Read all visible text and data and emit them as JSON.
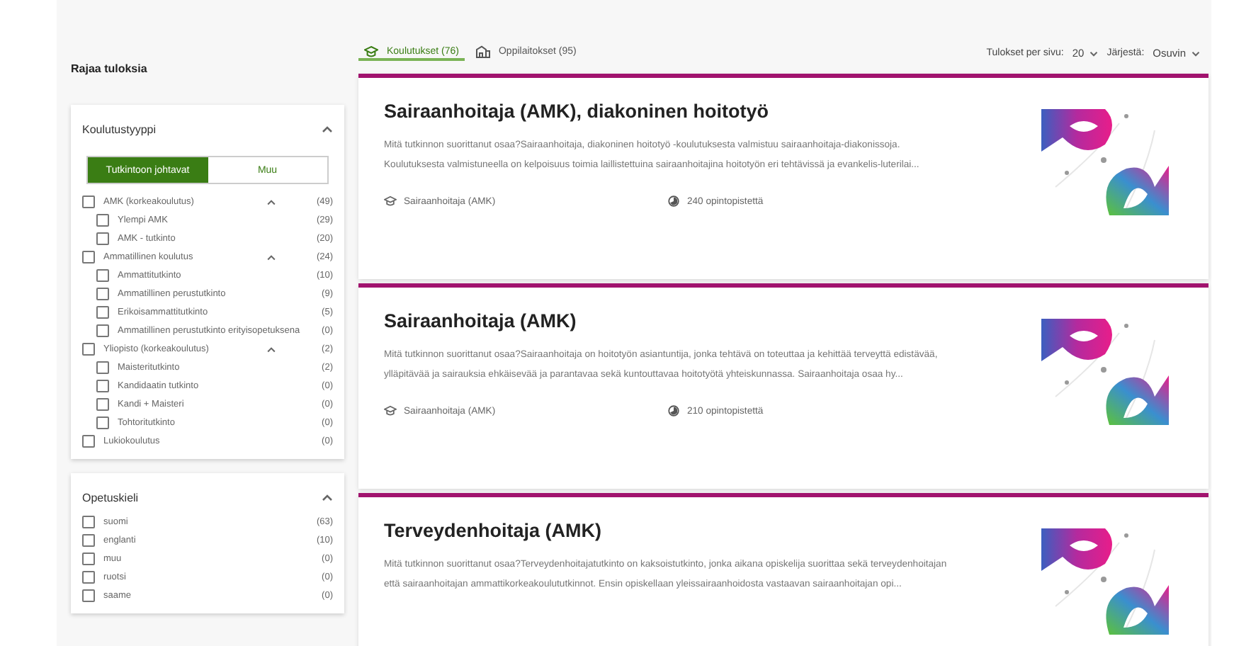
{
  "sidebar": {
    "title": "Rajaa tuloksia",
    "filters": [
      {
        "title": "Koulutustyyppi",
        "expanded": true,
        "toggle": [
          {
            "label": "Tutkintoon johtavat",
            "selected": true
          },
          {
            "label": "Muu",
            "selected": false
          }
        ],
        "items": [
          {
            "label": "AMK (korkeakoulutus)",
            "count": "(49)",
            "checked": false,
            "expanded": true,
            "children": [
              {
                "label": "Ylempi AMK",
                "count": "(29)",
                "checked": false
              },
              {
                "label": "AMK - tutkinto",
                "count": "(20)",
                "checked": false
              }
            ]
          },
          {
            "label": "Ammatillinen koulutus",
            "count": "(24)",
            "checked": false,
            "expanded": true,
            "children": [
              {
                "label": "Ammattitutkinto",
                "count": "(10)",
                "checked": false
              },
              {
                "label": "Ammatillinen perustutkinto",
                "count": "(9)",
                "checked": false
              },
              {
                "label": "Erikoisammattitutkinto",
                "count": "(5)",
                "checked": false
              },
              {
                "label": "Ammatillinen perustutkinto erityisopetuksena",
                "count": "(0)",
                "checked": false
              }
            ]
          },
          {
            "label": "Yliopisto (korkeakoulutus)",
            "count": "(2)",
            "checked": false,
            "expanded": true,
            "children": [
              {
                "label": "Maisteritutkinto",
                "count": "(2)",
                "checked": false
              },
              {
                "label": "Kandidaatin tutkinto",
                "count": "(0)",
                "checked": false
              },
              {
                "label": "Kandi + Maisteri",
                "count": "(0)",
                "checked": false
              },
              {
                "label": "Tohtoritutkinto",
                "count": "(0)",
                "checked": false
              }
            ]
          },
          {
            "label": "Lukiokoulutus",
            "count": "(0)",
            "checked": false
          }
        ]
      },
      {
        "title": "Opetuskieli",
        "expanded": true,
        "items": [
          {
            "label": "suomi",
            "count": "(63)",
            "checked": false
          },
          {
            "label": "englanti",
            "count": "(10)",
            "checked": false
          },
          {
            "label": "muu",
            "count": "(0)",
            "checked": false
          },
          {
            "label": "ruotsi",
            "count": "(0)",
            "checked": false
          },
          {
            "label": "saame",
            "count": "(0)",
            "checked": false
          }
        ]
      }
    ]
  },
  "tabs": [
    {
      "label": "Koulutukset (76)",
      "kind": "education",
      "selected": true
    },
    {
      "label": "Oppilaitokset (95)",
      "kind": "institution",
      "selected": false
    }
  ],
  "results_per_page": {
    "label": "Tulokset per sivu:",
    "value": "20"
  },
  "sort": {
    "label": "Järjestä:",
    "value": "Osuvin"
  },
  "results": [
    {
      "title": "Sairaanhoitaja (AMK), diakoninen hoitotyö",
      "description": "Mitä tutkinnon suorittanut osaa?Sairaanhoitaja, diakoninen hoitotyö -koulutuksesta valmistuu sairaanhoitaja-diakonissoja. Koulutuksesta valmistuneella on kelpoisuus toimia laillistettuina sairaanhoitajina hoitotyön eri tehtävissä ja evankelis-luterilai...",
      "degree": "Sairaanhoitaja (AMK)",
      "credits": "240 opintopistettä"
    },
    {
      "title": "Sairaanhoitaja (AMK)",
      "description": "Mitä tutkinnon suorittanut osaa?Sairaanhoitaja on hoitotyön asiantuntija, jonka tehtävä on toteuttaa ja kehittää terveyttä edistävää, ylläpitävää ja sairauksia ehkäisevää ja parantavaa sekä kuntouttavaa hoitotyötä yhteiskunnassa. Sairaanhoitaja osaa hy...",
      "degree": "Sairaanhoitaja (AMK)",
      "credits": "210 opintopistettä"
    },
    {
      "title": "Terveydenhoitaja (AMK)",
      "description": "Mitä tutkinnon suorittanut osaa?Terveydenhoitajatutkinto on kaksoistutkinto, jonka aikana opiskelija suorittaa sekä terveydenhoitajan että sairaanhoitajan ammattikorkeakoulututkinnot. Ensin opiskellaan yleissairaanhoidosta vastaavan sairaanhoitajan opi..."
    }
  ]
}
